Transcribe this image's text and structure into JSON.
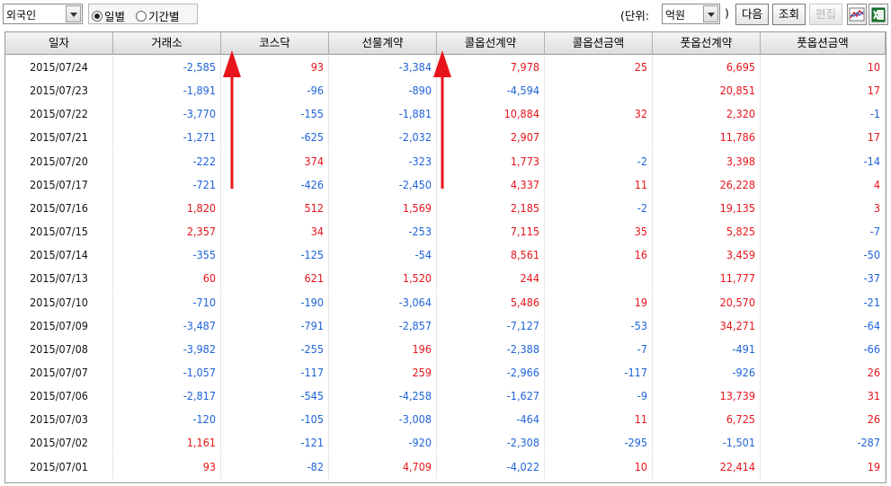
{
  "toolbar": {
    "investor_select": "외국인",
    "radio_daily": "일별",
    "radio_period": "기간별",
    "unit_prefix": "(단위:",
    "unit_select": "억원",
    "unit_suffix": ")",
    "next_button": "다음",
    "query_button": "조회",
    "edit_button": "편집",
    "chart_icon": "line-chart-icon",
    "excel_icon": "excel-icon"
  },
  "table": {
    "columns": [
      "일자",
      "거래소",
      "코스닥",
      "선물계약",
      "콜옵선계약",
      "콜옵션금액",
      "풋옵선계약",
      "풋옵션금액"
    ],
    "rows": [
      [
        "2015/07/24",
        "-2,585",
        "93",
        "-3,384",
        "7,978",
        "25",
        "6,695",
        "10"
      ],
      [
        "2015/07/23",
        "-1,891",
        "-96",
        "-890",
        "-4,594",
        "",
        "20,851",
        "17"
      ],
      [
        "2015/07/22",
        "-3,770",
        "-155",
        "-1,881",
        "10,884",
        "32",
        "2,320",
        "-1"
      ],
      [
        "2015/07/21",
        "-1,271",
        "-625",
        "-2,032",
        "2,907",
        "",
        "11,786",
        "17"
      ],
      [
        "2015/07/20",
        "-222",
        "374",
        "-323",
        "1,773",
        "-2",
        "3,398",
        "-14"
      ],
      [
        "2015/07/17",
        "-721",
        "-426",
        "-2,450",
        "4,337",
        "11",
        "26,228",
        "4"
      ],
      [
        "2015/07/16",
        "1,820",
        "512",
        "1,569",
        "2,185",
        "-2",
        "19,135",
        "3"
      ],
      [
        "2015/07/15",
        "2,357",
        "34",
        "-253",
        "7,115",
        "35",
        "5,825",
        "-7"
      ],
      [
        "2015/07/14",
        "-355",
        "-125",
        "-54",
        "8,561",
        "16",
        "3,459",
        "-50"
      ],
      [
        "2015/07/13",
        "60",
        "621",
        "1,520",
        "244",
        "",
        "11,777",
        "-37"
      ],
      [
        "2015/07/10",
        "-710",
        "-190",
        "-3,064",
        "5,486",
        "19",
        "20,570",
        "-21"
      ],
      [
        "2015/07/09",
        "-3,487",
        "-791",
        "-2,857",
        "-7,127",
        "-53",
        "34,271",
        "-64"
      ],
      [
        "2015/07/08",
        "-3,982",
        "-255",
        "196",
        "-2,388",
        "-7",
        "-491",
        "-66"
      ],
      [
        "2015/07/07",
        "-1,057",
        "-117",
        "259",
        "-2,966",
        "-117",
        "-926",
        "26"
      ],
      [
        "2015/07/06",
        "-2,817",
        "-545",
        "-4,258",
        "-1,627",
        "-9",
        "13,739",
        "31"
      ],
      [
        "2015/07/03",
        "-120",
        "-105",
        "-3,008",
        "-464",
        "11",
        "6,725",
        "26"
      ],
      [
        "2015/07/02",
        "1,161",
        "-121",
        "-920",
        "-2,308",
        "-295",
        "-1,501",
        "-287"
      ],
      [
        "2015/07/01",
        "93",
        "-82",
        "4,709",
        "-4,022",
        "10",
        "22,414",
        "19"
      ]
    ]
  },
  "colors": {
    "positive": "#e8141b",
    "negative": "#1f63d9",
    "arrow": "#e8141b"
  }
}
